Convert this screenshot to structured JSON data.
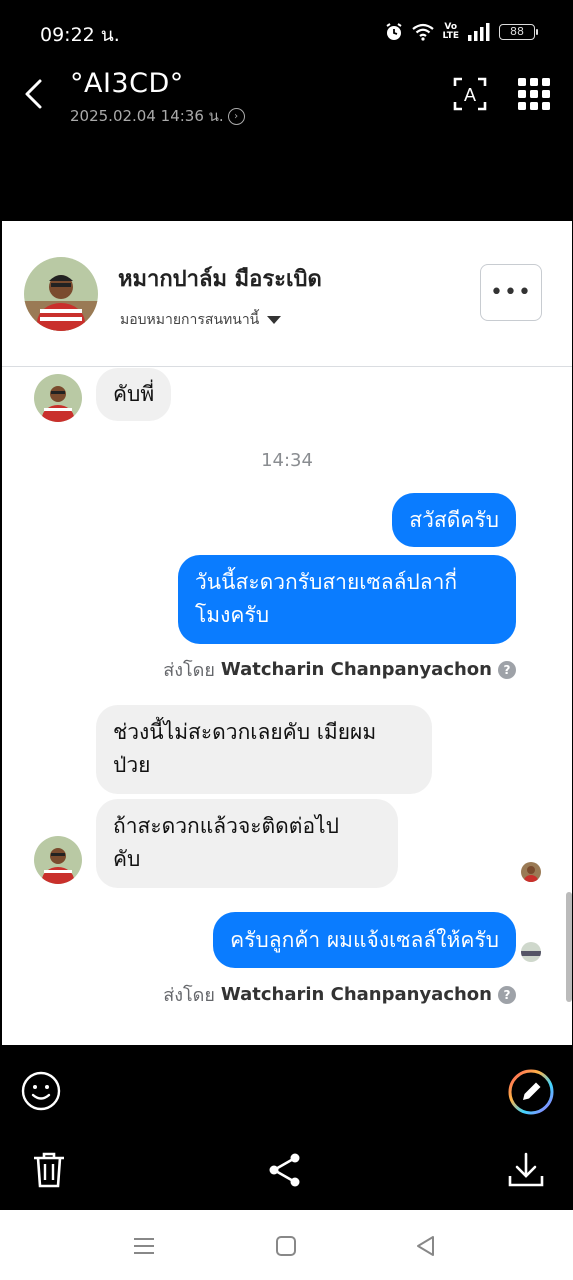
{
  "status": {
    "time": "09:22 น.",
    "volte_top": "Vo",
    "volte_bottom": "LTE",
    "battery": "88"
  },
  "viewer": {
    "title": "°AI3CD°",
    "subtitle": "2025.02.04 14:36 น."
  },
  "messenger": {
    "contact_name": "หมากปาล์ม มือระเบิด",
    "assign_label": "มอบหมายการสนทนานี้",
    "more_label": "•••",
    "timestamp": "14:34",
    "messages": [
      {
        "text": "คับพี่"
      },
      {
        "text": "สวัสดีครับ"
      },
      {
        "line1": "วันนี้สะดวกรับสายเซลล์ปลากี่",
        "line2": "โมงครับ"
      },
      {
        "line1": "ช่วงนี้ไม่สะดวกเลยคับ เมียผม",
        "line2": "ป่วย"
      },
      {
        "line1": "ถ้าสะดวกแล้วจะติดต่อไป",
        "line2": "คับ"
      },
      {
        "text": "ครับลูกค้า ผมแจ้งเซลล์ให้ครับ"
      }
    ],
    "sent_by_prefix": "ส่งโดย",
    "sent_by_name": "Watcharin Chanpanyachon"
  },
  "colors": {
    "outgoing_bubble": "#0a7cff",
    "incoming_bubble": "#f0f0f0"
  }
}
